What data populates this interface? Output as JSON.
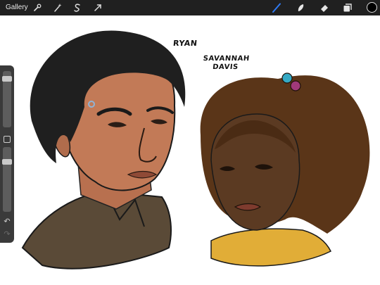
{
  "toolbar": {
    "gallery_label": "Gallery",
    "left_icons": [
      "wrench-icon",
      "magic-wand-icon",
      "selection-icon",
      "transform-arrow-icon"
    ],
    "right_icons": [
      "brush-icon",
      "smudge-icon",
      "eraser-icon",
      "layers-icon"
    ],
    "active_tool": "brush",
    "accent_color": "#2f7bf5",
    "current_color": "#000000"
  },
  "canvas": {
    "labels": {
      "ryan": "RYAN",
      "savannah_line1": "SAVANNAH",
      "savannah_line2": "DAVIS"
    }
  },
  "sidebar": {
    "brush_size_level": 0.9,
    "opacity_level": 0.8
  }
}
